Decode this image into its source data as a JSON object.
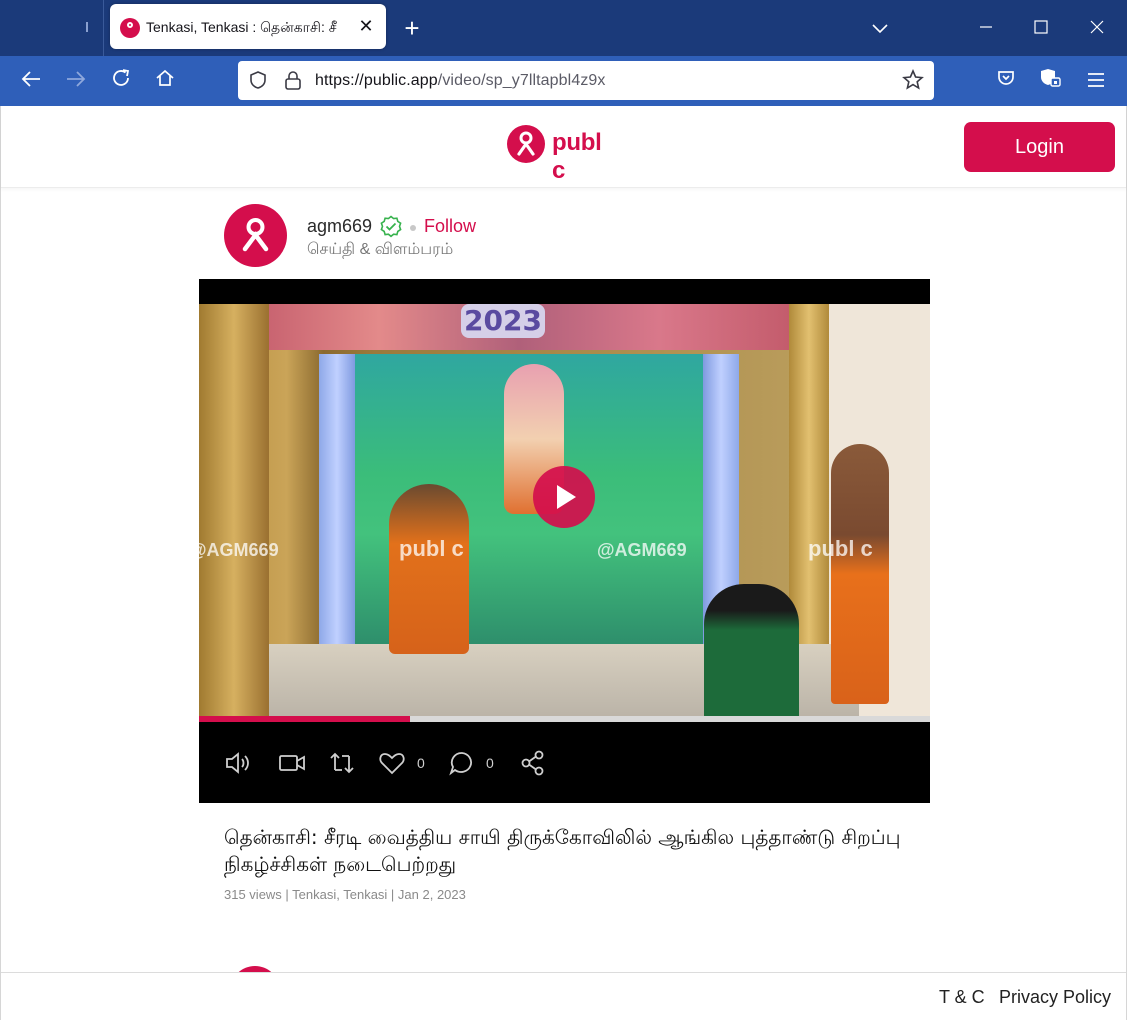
{
  "browser": {
    "tab_title": "Tenkasi, Tenkasi : தென்காசி: சீ",
    "close_glyph": "✕",
    "new_tab_glyph": "+",
    "url_domain": "https://public.app",
    "url_path": "/video/sp_y7lltapbl4z9x"
  },
  "header": {
    "logo_text": "publ c",
    "login_label": "Login"
  },
  "post": {
    "username": "agm669",
    "follow_label": "Follow",
    "category": "செய்தி & விளம்பரம்",
    "video": {
      "year_banner": "2023",
      "watermark_left": "@AGM669",
      "watermark_center": "@AGM669",
      "watermark_brand": "publ c",
      "progress_fraction": 0.288,
      "like_count": "0",
      "comment_count": "0"
    },
    "caption": "தென்காசி: சீரடி வைத்திய சாயி திருக்கோவிலில் ஆங்கில புத்தாண்டு சிறப்பு நிகழ்ச்சிகள் நடைபெற்றது",
    "meta": "315 views | Tenkasi, Tenkasi | Jan 2, 2023"
  },
  "footer": {
    "tc_label": "T & C",
    "privacy_label": "Privacy Policy"
  },
  "colors": {
    "brand": "#d40e4c",
    "chrome_tabbar": "#1b3a7a",
    "chrome_navbar": "#2f5fb9"
  },
  "icons": [
    "shield-icon",
    "lock-icon",
    "star-icon",
    "pocket-icon",
    "extension-icon",
    "menu-icon",
    "speaker-icon",
    "camera-icon",
    "repost-icon",
    "heart-icon",
    "comment-icon",
    "share-icon",
    "verified-icon",
    "play-icon"
  ]
}
